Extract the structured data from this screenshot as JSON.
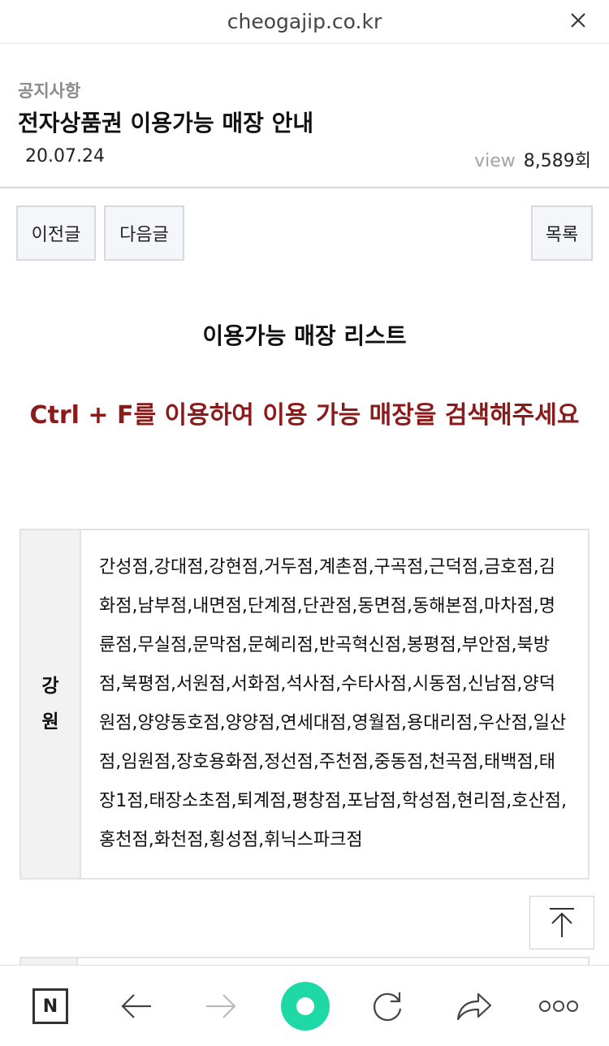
{
  "browser": {
    "url": "cheogajip.co.kr"
  },
  "post": {
    "category": "공지사항",
    "title": "전자상품권 이용가능 매장 안내",
    "date": "20.07.24",
    "view_label": "view",
    "view_count": "8,589회"
  },
  "nav": {
    "prev_label": "이전글",
    "next_label": "다음글",
    "list_label": "목록"
  },
  "content": {
    "list_title": "이용가능 매장 리스트",
    "notice": "Ctrl + F를 이용하여 이용 가능 매장을 검색해주세요",
    "regions": [
      {
        "name": "강원",
        "stores": "간성점,강대점,강현점,거두점,계촌점,구곡점,근덕점,금호점,김화점,남부점,내면점,단계점,단관점,동면점,동해본점,마차점,명륜점,무실점,문막점,문혜리점,반곡혁신점,봉평점,부안점,북방점,북평점,서원점,서화점,석사점,수타사점,시동점,신남점,양덕원점,양양동호점,양양점,연세대점,영월점,용대리점,우산점,일산점,임원점,장호용화점,정선점,주천점,중동점,천곡점,태백점,태장1점,태장소초점,퇴계점,평창점,포남점,학성점,현리점,호산점,홍천점,화천점,횡성점,휘닉스파크점"
      }
    ]
  },
  "icons": {
    "close": "close-icon",
    "to_top": "arrow-up-to-top-icon",
    "n_home": "naver-n-icon",
    "back": "arrow-left-icon",
    "forward": "arrow-right-icon",
    "green_home": "green-dot-icon",
    "reload": "reload-icon",
    "share": "share-icon",
    "more": "more-dots-icon"
  },
  "colors": {
    "notice_red": "#8b1a1a",
    "green_button": "#1ed8a6",
    "button_bg": "#f4f6f9"
  }
}
